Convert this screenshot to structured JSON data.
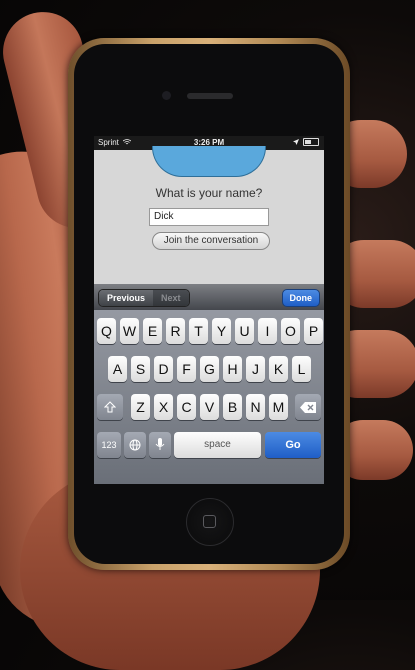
{
  "status_bar": {
    "carrier": "Sprint",
    "time": "3:26 PM",
    "wifi_icon": "wifi-icon",
    "location_icon": "location-arrow-icon"
  },
  "app": {
    "question": "What is your name?",
    "name_input_value": "Dick",
    "join_button": "Join the conversation"
  },
  "toolbar": {
    "previous": "Previous",
    "next": "Next",
    "done": "Done"
  },
  "keyboard": {
    "row1": [
      "Q",
      "W",
      "E",
      "R",
      "T",
      "Y",
      "U",
      "I",
      "O",
      "P"
    ],
    "row2": [
      "A",
      "S",
      "D",
      "F",
      "G",
      "H",
      "J",
      "K",
      "L"
    ],
    "row3": [
      "Z",
      "X",
      "C",
      "V",
      "B",
      "N",
      "M"
    ],
    "shift_icon": "shift-icon",
    "delete_icon": "backspace-icon",
    "numbers": "123",
    "globe_icon": "globe-icon",
    "mic_icon": "microphone-icon",
    "space": "space",
    "go": "Go"
  }
}
